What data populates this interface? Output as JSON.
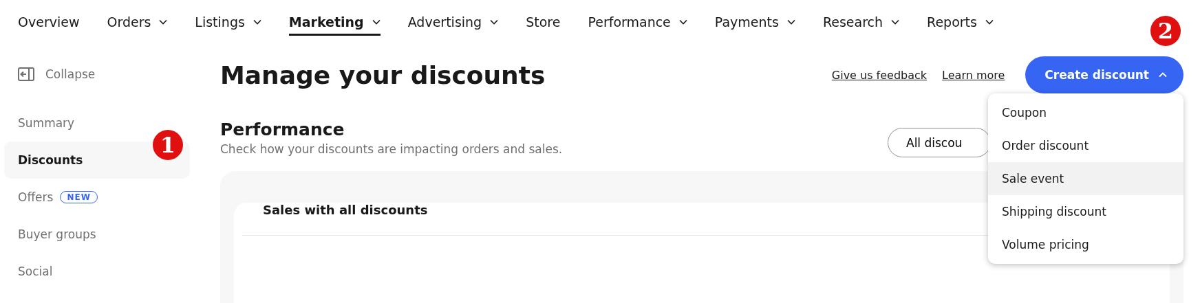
{
  "nav": [
    {
      "label": "Overview",
      "has_menu": false,
      "selected": false
    },
    {
      "label": "Orders",
      "has_menu": true,
      "selected": false
    },
    {
      "label": "Listings",
      "has_menu": true,
      "selected": false
    },
    {
      "label": "Marketing",
      "has_menu": true,
      "selected": true
    },
    {
      "label": "Advertising",
      "has_menu": true,
      "selected": false
    },
    {
      "label": "Store",
      "has_menu": false,
      "selected": false
    },
    {
      "label": "Performance",
      "has_menu": true,
      "selected": false
    },
    {
      "label": "Payments",
      "has_menu": true,
      "selected": false
    },
    {
      "label": "Research",
      "has_menu": true,
      "selected": false
    },
    {
      "label": "Reports",
      "has_menu": true,
      "selected": false
    }
  ],
  "sidebar": {
    "collapse": "Collapse",
    "items": [
      {
        "label": "Summary",
        "selected": false
      },
      {
        "label": "Discounts",
        "selected": true
      },
      {
        "label": "Offers",
        "selected": false,
        "badge": "NEW"
      },
      {
        "label": "Buyer groups",
        "selected": false
      },
      {
        "label": "Social",
        "selected": false
      }
    ]
  },
  "header": {
    "title": "Manage your discounts",
    "links": [
      "Give us feedback",
      "Learn more"
    ],
    "create_button": {
      "label": "Create discount",
      "expanded": true
    }
  },
  "performance": {
    "title": "Performance",
    "subtitle": "Check how your discounts are impacting orders and sales.",
    "filter": "All discou",
    "card_title": "Sales with all discounts"
  },
  "dropdown": [
    {
      "label": "Coupon",
      "selected": false
    },
    {
      "label": "Order discount",
      "selected": false
    },
    {
      "label": "Sale event",
      "selected": true
    },
    {
      "label": "Shipping discount",
      "selected": false
    },
    {
      "label": "Volume pricing",
      "selected": false
    }
  ],
  "annotations": [
    {
      "label": "1"
    },
    {
      "label": "2"
    }
  ]
}
